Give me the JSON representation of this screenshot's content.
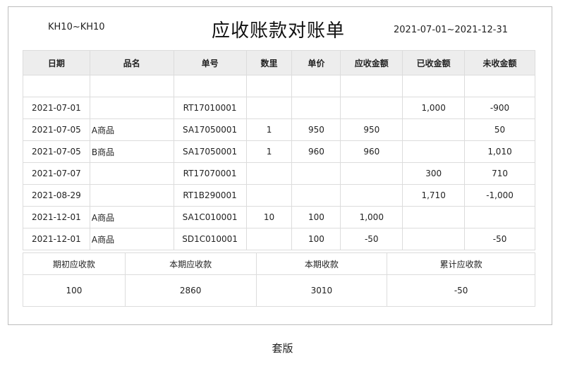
{
  "header": {
    "left": "KH10~KH10",
    "title": "应收账款对账单",
    "range": "2021-07-01~2021-12-31"
  },
  "columns": [
    "日期",
    "品名",
    "单号",
    "数里",
    "单价",
    "应收金额",
    "已收金额",
    "未收金额"
  ],
  "rows": [
    [
      "",
      "",
      "",
      "",
      "",
      "",
      "",
      ""
    ],
    [
      "2021-07-01",
      "",
      "RT17010001",
      "",
      "",
      "",
      "1,000",
      "-900"
    ],
    [
      "2021-07-05",
      "A商品",
      "SA17050001",
      "1",
      "950",
      "950",
      "",
      "50"
    ],
    [
      "2021-07-05",
      "B商品",
      "SA17050001",
      "1",
      "960",
      "960",
      "",
      "1,010"
    ],
    [
      "2021-07-07",
      "",
      "RT17070001",
      "",
      "",
      "",
      "300",
      "710"
    ],
    [
      "2021-08-29",
      "",
      "RT1B290001",
      "",
      "",
      "",
      "1,710",
      "-1,000"
    ],
    [
      "2021-12-01",
      "A商品",
      "SA1C010001",
      "10",
      "100",
      "1,000",
      "",
      ""
    ],
    [
      "2021-12-01",
      "A商品",
      "SD1C010001",
      "",
      "100",
      "-50",
      "",
      "-50"
    ]
  ],
  "summary": {
    "labels": [
      "期初应收款",
      "本期应收款",
      "本期收款",
      "累计应收款"
    ],
    "values": [
      "100",
      "2860",
      "3010",
      "-50"
    ]
  },
  "caption": "套版"
}
